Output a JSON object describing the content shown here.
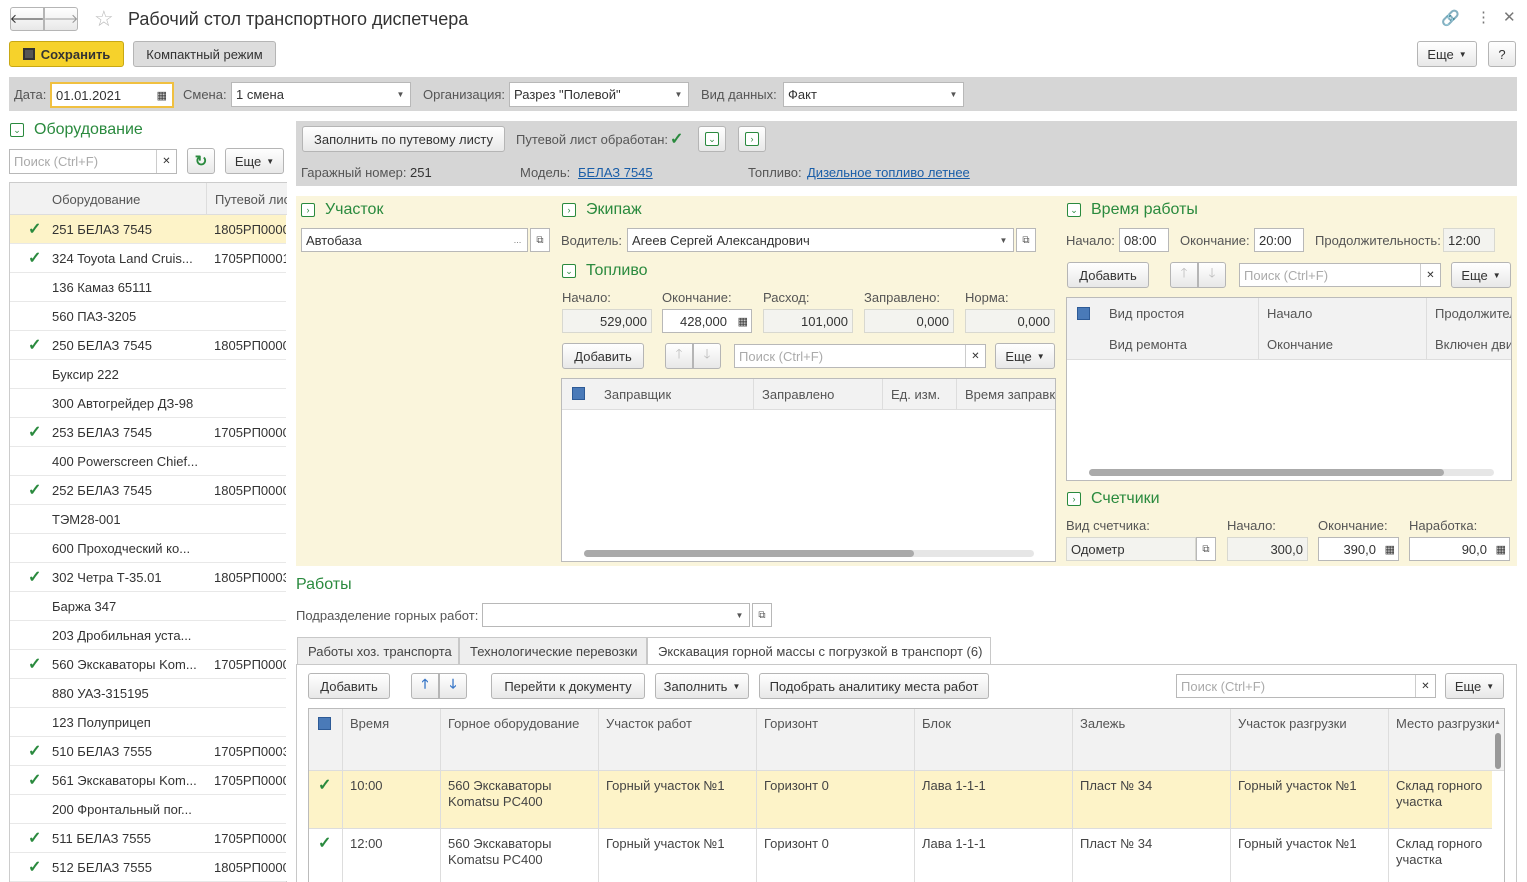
{
  "window": {
    "title": "Рабочий стол транспортного диспетчера"
  },
  "toolbar": {
    "save": "Сохранить",
    "compact": "Компактный режим",
    "more": "Еще",
    "help": "?"
  },
  "filters": {
    "date_label": "Дата:",
    "date": "01.01.2021",
    "shift_label": "Смена:",
    "shift": "1 смена",
    "org_label": "Организация:",
    "org": "Разрез \"Полевой\"",
    "datatype_label": "Вид данных:",
    "datatype": "Факт"
  },
  "equipment": {
    "title": "Оборудование",
    "search_placeholder": "Поиск (Ctrl+F)",
    "more": "Еще",
    "col1": "Оборудование",
    "col2": "Путевой лист",
    "rows": [
      {
        "checked": true,
        "name": "251 БЕЛАЗ 7545",
        "doc": "1805РП0000"
      },
      {
        "checked": true,
        "name": "324 Toyota Land Cruis...",
        "doc": "1705РП0001"
      },
      {
        "checked": false,
        "name": "136 Камаз 65111",
        "doc": ""
      },
      {
        "checked": false,
        "name": "560 ПАЗ-3205",
        "doc": ""
      },
      {
        "checked": true,
        "name": "250 БЕЛАЗ 7545",
        "doc": "1805РП0000"
      },
      {
        "checked": false,
        "name": "Буксир 222",
        "doc": ""
      },
      {
        "checked": false,
        "name": "300 Автогрейдер ДЗ-98",
        "doc": ""
      },
      {
        "checked": true,
        "name": "253 БЕЛАЗ 7545",
        "doc": "1705РП0000"
      },
      {
        "checked": false,
        "name": "400 Powerscreen Chief...",
        "doc": ""
      },
      {
        "checked": true,
        "name": "252 БЕЛАЗ 7545",
        "doc": "1805РП0000"
      },
      {
        "checked": false,
        "name": "ТЭМ28-001",
        "doc": ""
      },
      {
        "checked": false,
        "name": "600 Проходческий ко...",
        "doc": ""
      },
      {
        "checked": true,
        "name": "302 Четра Т-35.01",
        "doc": "1805РП0003"
      },
      {
        "checked": false,
        "name": "Баржа 347",
        "doc": ""
      },
      {
        "checked": false,
        "name": "203 Дробильная уста...",
        "doc": ""
      },
      {
        "checked": true,
        "name": "560 Экскаваторы Kom...",
        "doc": "1705РП0000"
      },
      {
        "checked": false,
        "name": "880 УАЗ-315195",
        "doc": ""
      },
      {
        "checked": false,
        "name": "123 Полуприцеп",
        "doc": ""
      },
      {
        "checked": true,
        "name": "510 БЕЛАЗ 7555",
        "doc": "1705РП0003"
      },
      {
        "checked": true,
        "name": "561 Экскаваторы Kom...",
        "doc": "1705РП0000"
      },
      {
        "checked": false,
        "name": "200 Фронтальный пог...",
        "doc": ""
      },
      {
        "checked": true,
        "name": "511 БЕЛАЗ 7555",
        "doc": "1705РП0000"
      },
      {
        "checked": true,
        "name": "512 БЕЛАЗ 7555",
        "doc": "1805РП0000"
      }
    ]
  },
  "waybill": {
    "fill_btn": "Заполнить по путевому листу",
    "processed_label": "Путевой лист обработан:",
    "garage_label": "Гаражный номер:",
    "garage": "251",
    "model_label": "Модель:",
    "model": "БЕЛАЗ 7545",
    "fuel_label": "Топливо:",
    "fuel": "Дизельное топливо летнее"
  },
  "site": {
    "title": "Участок",
    "value": "Автобаза"
  },
  "crew": {
    "title": "Экипаж",
    "driver_label": "Водитель:",
    "driver": "Агеев Сергей Александрович"
  },
  "fuel": {
    "title": "Топливо",
    "start_label": "Начало:",
    "start": "529,000",
    "end_label": "Окончание:",
    "end": "428,000",
    "usage_label": "Расход:",
    "usage": "101,000",
    "filled_label": "Заправлено:",
    "filled": "0,000",
    "norm_label": "Норма:",
    "norm": "0,000",
    "add": "Добавить",
    "search_placeholder": "Поиск (Ctrl+F)",
    "more": "Еще",
    "cols": [
      "Заправщик",
      "Заправлено",
      "Ед. изм.",
      "Время заправк"
    ]
  },
  "worktime": {
    "title": "Время работы",
    "start_label": "Начало:",
    "start": "08:00",
    "end_label": "Окончание:",
    "end": "20:00",
    "dur_label": "Продолжительность:",
    "dur": "12:00",
    "add": "Добавить",
    "search_placeholder": "Поиск (Ctrl+F)",
    "more": "Еще",
    "cols1": [
      "Вид простоя",
      "Начало",
      "Продолжител"
    ],
    "cols2": [
      "Вид ремонта",
      "Окончание",
      "Включен дви"
    ]
  },
  "counters": {
    "title": "Счетчики",
    "type_label": "Вид счетчика:",
    "type": "Одометр",
    "start_label": "Начало:",
    "start": "300,0",
    "end_label": "Окончание:",
    "end": "390,0",
    "run_label": "Наработка:",
    "run": "90,0"
  },
  "works": {
    "title": "Работы",
    "subdiv_label": "Подразделение горных работ:",
    "tabs": [
      "Работы хоз. транспорта",
      "Технологические перевозки",
      "Экскавация горной массы с погрузкой в транспорт (6)"
    ],
    "add": "Добавить",
    "goto": "Перейти к документу",
    "fill": "Заполнить",
    "pick": "Подобрать аналитику места работ",
    "search_placeholder": "Поиск (Ctrl+F)",
    "more": "Еще",
    "cols": [
      "Время",
      "Горное оборудование",
      "Участок работ",
      "Горизонт",
      "Блок",
      "Залежь",
      "Участок разгрузки",
      "Место разгрузки"
    ],
    "rows": [
      {
        "time": "10:00",
        "equip1": "560 Экскаваторы",
        "equip2": "Komatsu PC400",
        "site": "Горный участок №1",
        "horizon": "Горизонт 0",
        "block": "Лава 1-1-1",
        "deposit": "Пласт № 34",
        "unload": "Горный участок №1",
        "place1": "Склад горного",
        "place2": "участка"
      },
      {
        "time": "12:00",
        "equip1": "560 Экскаваторы",
        "equip2": "Komatsu PC400",
        "site": "Горный участок №1",
        "horizon": "Горизонт 0",
        "block": "Лава 1-1-1",
        "deposit": "Пласт № 34",
        "unload": "Горный участок №1",
        "place1": "Склад горного",
        "place2": "участка"
      }
    ]
  }
}
